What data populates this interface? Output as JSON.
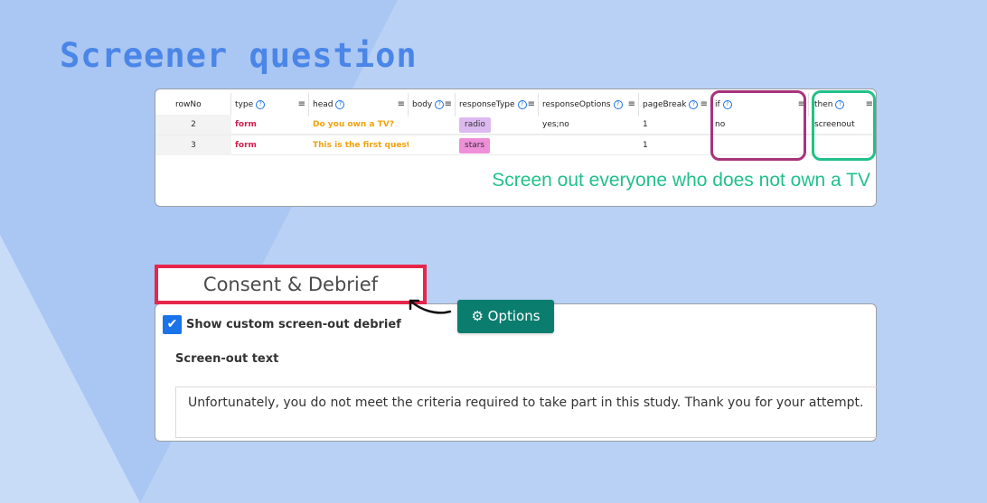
{
  "page": {
    "title": "Screener question"
  },
  "sheet": {
    "headers": [
      "rowNo",
      "type",
      "head",
      "body",
      "responseType",
      "responseOptions",
      "pageBreak",
      "if",
      "then"
    ],
    "rows": [
      {
        "rowNo": "2",
        "type": "form",
        "head": "Do you own a TV?",
        "body": "",
        "responseType": "radio",
        "responseOptions": "yes;no",
        "pageBreak": "1",
        "if": "no",
        "then": "screenout"
      },
      {
        "rowNo": "3",
        "type": "form",
        "head": "This is the first questio",
        "body": "",
        "responseType": "stars",
        "responseOptions": "",
        "pageBreak": "1",
        "if": "",
        "then": ""
      }
    ],
    "annotation": "Screen out everyone who does not own a TV"
  },
  "consent": {
    "tab_label": "Consent & Debrief",
    "options_label": "Options",
    "checkbox_checked": true,
    "checkbox_label": "Show custom screen-out debrief",
    "screenout_label": "Screen-out text",
    "screenout_text": "Unfortunately, you do not meet the criteria required to take part in this study. Thank you for your attempt."
  },
  "colors": {
    "background": "#b9d1f4",
    "title": "#4a86e8",
    "if_highlight": "#a7347b",
    "then_highlight": "#22c18a",
    "tab_highlight": "#e7264b",
    "options_button": "#0b7d6f"
  }
}
